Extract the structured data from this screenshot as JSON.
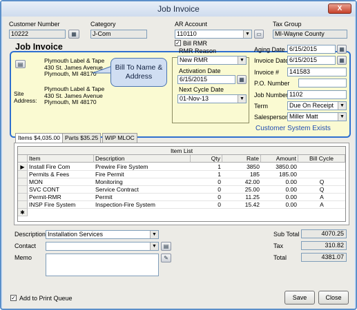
{
  "window": {
    "title": "Job Invoice",
    "close_glyph": "X"
  },
  "header": {
    "customer_number_label": "Customer Number",
    "customer_number": "10222",
    "category_label": "Category",
    "category": "J-Com",
    "ar_account_label": "AR Account",
    "ar_account": "110110",
    "tax_group_label": "Tax Group",
    "tax_group": "MI-Wayne County"
  },
  "invoice": {
    "heading": "Job Invoice",
    "bill_to_lines": [
      "Plymouth Label & Tape",
      "430 St. James Avenue",
      "Plymouth, MI  48170"
    ],
    "site_label_1": "Site",
    "site_label_2": "Address:",
    "site_lines": [
      "Plymouth Label & Tape",
      "430 St. James Avenue",
      "Plymouth, MI  48170"
    ],
    "callout": "Bill To Name & Address"
  },
  "bill_rmr": {
    "checkbox_label": "Bill RMR",
    "checked": true,
    "reason_label": "RMR Reason",
    "reason": "New RMR",
    "activation_label": "Activation Date",
    "activation_date": "6/15/2015",
    "next_cycle_label": "Next Cycle Date",
    "next_cycle_date": "01-Nov-13"
  },
  "details": {
    "aging_date_label": "Aging Date",
    "aging_date": "6/15/2015",
    "invoice_date_label": "Invoice Date",
    "invoice_date": "6/15/2015",
    "invoice_number_label": "Invoice #",
    "invoice_number": "141583",
    "po_label": "P.O. Number",
    "po_number": "",
    "job_number_label": "Job Number",
    "job_number": "1102",
    "term_label": "Term",
    "term": "Due On Receipt",
    "salesperson_label": "Salesperson",
    "salesperson": "Miller Matt",
    "customer_system_link": "Customer System Exists"
  },
  "tabs": [
    {
      "label": "Items  $4,035.00"
    },
    {
      "label": "Parts  $35.25"
    },
    {
      "label": "WIP MLOC"
    }
  ],
  "item_list": {
    "title": "Item List",
    "columns": [
      "Item",
      "Description",
      "Qty",
      "Rate",
      "Amount",
      "Bill Cycle"
    ],
    "rows": [
      {
        "item": "Install Fire Com",
        "description": "Prewire Fire System",
        "qty": "1",
        "rate": "3850",
        "amount": "3850.00",
        "cycle": ""
      },
      {
        "item": "Permits & Fees",
        "description": "Fire Permit",
        "qty": "1",
        "rate": "185",
        "amount": "185.00",
        "cycle": ""
      },
      {
        "item": "MON",
        "description": "Monitoring",
        "qty": "0",
        "rate": "42.00",
        "amount": "0.00",
        "cycle": "Q"
      },
      {
        "item": "SVC CONT",
        "description": "Service Contract",
        "qty": "0",
        "rate": "25.00",
        "amount": "0.00",
        "cycle": "Q"
      },
      {
        "item": "Permit-RMR",
        "description": "Permit",
        "qty": "0",
        "rate": "11.25",
        "amount": "0.00",
        "cycle": "A"
      },
      {
        "item": "INSP Fire System",
        "description": "Inspection-Fire System",
        "qty": "0",
        "rate": "15.42",
        "amount": "0.00",
        "cycle": "A"
      }
    ],
    "current_row_glyph": "▶",
    "new_row_glyph": "✱"
  },
  "footer": {
    "description_label": "Description",
    "description": "Installation Services",
    "contact_label": "Contact",
    "contact": "",
    "memo_label": "Memo",
    "memo": "",
    "subtotal_label": "Sub Total",
    "subtotal": "4070.25",
    "tax_label": "Tax",
    "tax": "310.82",
    "total_label": "Total",
    "total": "4381.07",
    "print_queue_label": "Add to Print Queue",
    "print_queue_checked": true,
    "save_label": "Save",
    "close_label": "Close"
  }
}
